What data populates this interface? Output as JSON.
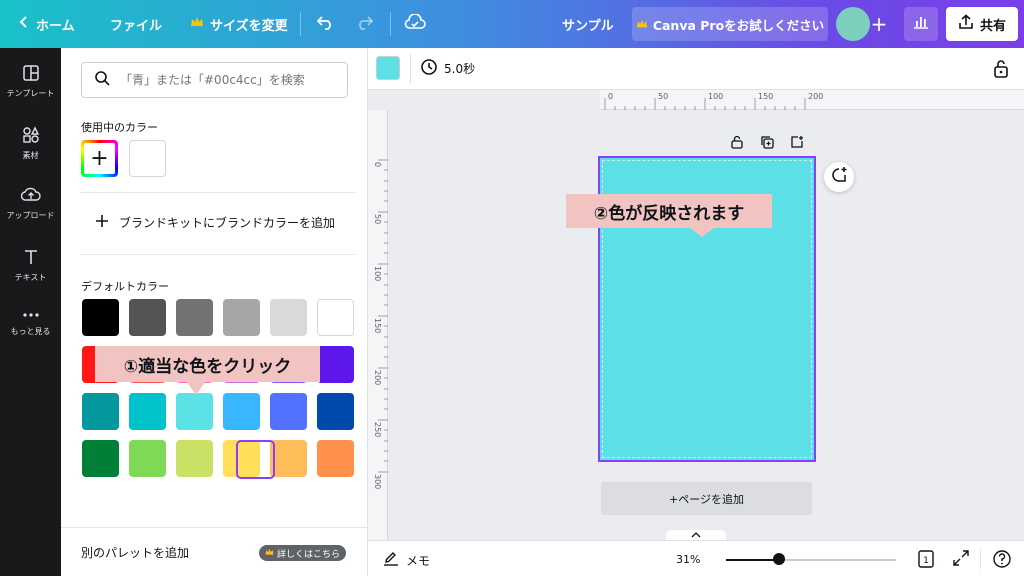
{
  "topbar": {
    "home_label": "ホーム",
    "file_label": "ファイル",
    "resize_label": "サイズを変更",
    "sample_label": "サンプル",
    "pro_label": "Canva Proをお試しください",
    "share_label": "共有"
  },
  "rail": {
    "items": [
      {
        "label": "テンプレート",
        "icon": "template-icon"
      },
      {
        "label": "素材",
        "icon": "elements-icon"
      },
      {
        "label": "アップロード",
        "icon": "upload-icon"
      },
      {
        "label": "テキスト",
        "icon": "text-icon"
      },
      {
        "label": "もっと見る",
        "icon": "more-icon"
      }
    ]
  },
  "panel": {
    "search_placeholder": "「青」または「#00c4cc」を検索",
    "in_use_label": "使用中のカラー",
    "brand_add_label": "ブランドキットにブランドカラーを追加",
    "default_label": "デフォルトカラー",
    "default_rows": [
      [
        "#000000",
        "#545454",
        "#737373",
        "#a6a6a6",
        "#d9d9d9",
        "#ffffff"
      ],
      [
        "#ff1616",
        "#ff5757",
        "#ff66c4",
        "#cb6ce6",
        "#8c52ff",
        "#5e17eb"
      ],
      [
        "#03989e",
        "#00c2cb",
        "#5ce1e6",
        "#38b6ff",
        "#5271ff",
        "#004aad"
      ],
      [
        "#008037",
        "#7ed957",
        "#c9e265",
        "#ffde59",
        "#ffbd59",
        "#ff914d"
      ]
    ],
    "add_palette_label": "別のパレットを追加",
    "learn_more_label": "詳しくはこちら"
  },
  "annotations": {
    "step1": "①適当な色をクリック",
    "step2": "②色が反映されます"
  },
  "toolbar": {
    "selected_color": "#5ce0e6",
    "duration": "5.0秒"
  },
  "canvas": {
    "page_color": "#5ce0e6",
    "ruler_top": [
      "0",
      "50",
      "100",
      "150",
      "200"
    ],
    "ruler_left": [
      "0",
      "50",
      "100",
      "150",
      "200",
      "250",
      "300"
    ],
    "add_page_label": "+ページを追加"
  },
  "bottombar": {
    "notes_label": "メモ",
    "zoom": "31%",
    "zoom_fraction": 0.31,
    "page_count": "1"
  }
}
